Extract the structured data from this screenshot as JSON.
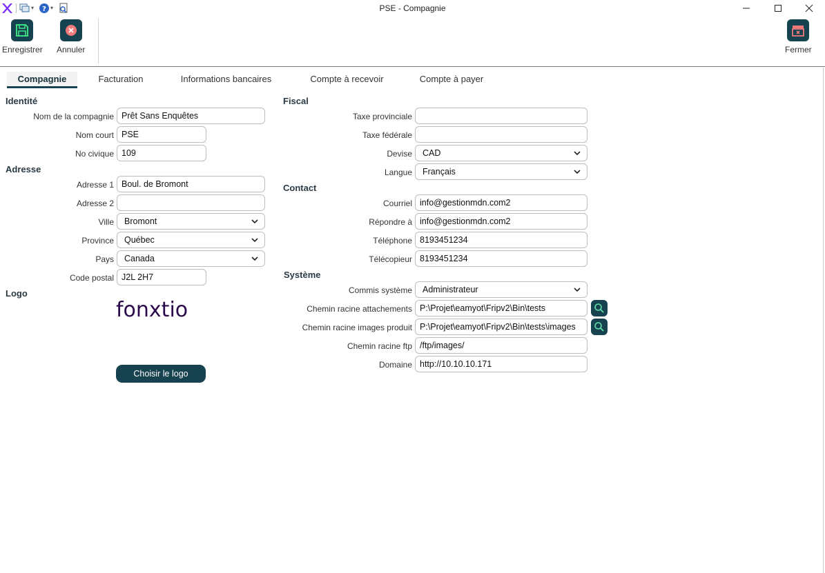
{
  "window": {
    "title": "PSE - Compagnie"
  },
  "ribbon": {
    "save_label": "Enregistrer",
    "cancel_label": "Annuler",
    "close_label": "Fermer"
  },
  "tabs": [
    "Compagnie",
    "Facturation",
    "Informations bancaires",
    "Compte à recevoir",
    "Compte à payer"
  ],
  "identite": {
    "heading": "Identité",
    "company_name_label": "Nom de la compagnie",
    "company_name": "Prêt Sans Enquêtes",
    "short_name_label": "Nom court",
    "short_name": "PSE",
    "civic_label": "No civique",
    "civic": "109"
  },
  "adresse": {
    "heading": "Adresse",
    "addr1_label": "Adresse 1",
    "addr1": "Boul. de Bromont",
    "addr2_label": "Adresse 2",
    "addr2": "",
    "city_label": "Ville",
    "city": "Bromont",
    "province_label": "Province",
    "province": "Québec",
    "country_label": "Pays",
    "country": "Canada",
    "postal_label": "Code postal",
    "postal": "J2L 2H7"
  },
  "logo": {
    "heading": "Logo",
    "brand_text": "fonxtio",
    "choose_label": "Choisir le logo"
  },
  "fiscal": {
    "heading": "Fiscal",
    "prov_tax_label": "Taxe provinciale",
    "prov_tax": "",
    "fed_tax_label": "Taxe fédérale",
    "fed_tax": "",
    "currency_label": "Devise",
    "currency": "CAD",
    "language_label": "Langue",
    "language": "Français"
  },
  "contact": {
    "heading": "Contact",
    "email_label": "Courriel",
    "email": "info@gestionmdn.com2",
    "reply_label": "Répondre à",
    "reply": "info@gestionmdn.com2",
    "phone_label": "Téléphone",
    "phone": "8193451234",
    "fax_label": "Télécopieur",
    "fax": "8193451234"
  },
  "systeme": {
    "heading": "Système",
    "clerk_label": "Commis système",
    "clerk": "Administrateur",
    "attach_label": "Chemin racine attachements",
    "attach": "P:\\Projet\\eamyot\\Fripv2\\Bin\\tests",
    "images_label": "Chemin racine images produit",
    "images": "P:\\Projet\\eamyot\\Fripv2\\Bin\\tests\\images",
    "ftp_label": "Chemin racine ftp",
    "ftp": "/ftp/images/",
    "domain_label": "Domaine",
    "domain": "http://10.10.10.171"
  },
  "colors": {
    "accent": "#17424f",
    "save_icon": "#3ddc84",
    "cancel_icon": "#f07a7a",
    "close_icon": "#f07a7a",
    "logo_purple": "#2a0a4a",
    "logo_accent": "#7a2cff"
  }
}
